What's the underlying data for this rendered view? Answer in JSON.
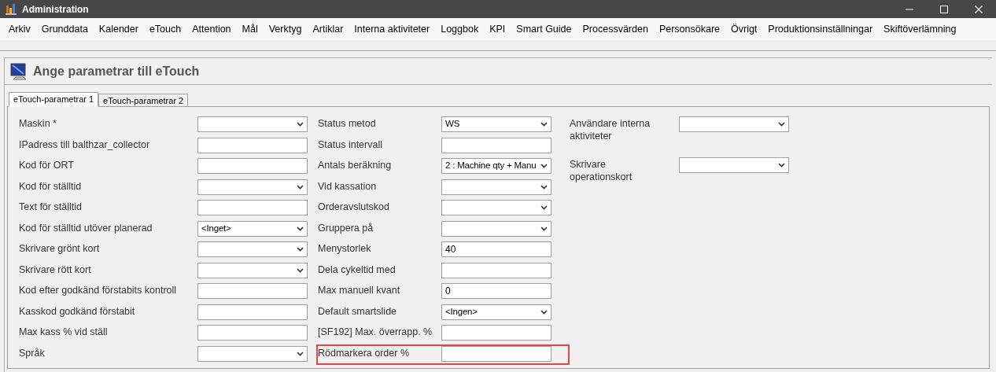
{
  "window": {
    "title": "Administration"
  },
  "menu": [
    "Arkiv",
    "Grunddata",
    "Kalender",
    "eTouch",
    "Attention",
    "Mål",
    "Verktyg",
    "Artiklar",
    "Interna aktiviteter",
    "Loggbok",
    "KPI",
    "Smart Guide",
    "Processvärden",
    "Personsökare",
    "Övrigt",
    "Produktionsinställningar",
    "Skiftöverlämning"
  ],
  "panel": {
    "title": "Ange parametrar till eTouch"
  },
  "tabs": [
    {
      "label": "eTouch-parametrar 1",
      "selected": true
    },
    {
      "label": "eTouch-parametrar 2",
      "selected": false
    }
  ],
  "columns": [
    [
      {
        "label": "Maskin *",
        "kind": "select",
        "highlighted": false
      },
      {
        "label": "IPadress till balthzar_collector",
        "kind": "text",
        "highlighted": false
      },
      {
        "label": "Kod för ORT",
        "kind": "text",
        "highlighted": false
      },
      {
        "label": "Kod för ställtid",
        "kind": "select",
        "highlighted": false
      },
      {
        "label": "Text för ställtid",
        "kind": "text",
        "highlighted": false
      },
      {
        "label": "Kod för ställtid utöver planerad",
        "kind": "select",
        "value": "<Inget>",
        "highlighted": false
      },
      {
        "label": "Skrivare grönt kort",
        "kind": "select",
        "highlighted": false
      },
      {
        "label": "Skrivare rött kort",
        "kind": "select",
        "highlighted": false
      },
      {
        "label": "Kod efter godkänd förstabits kontroll",
        "kind": "text",
        "highlighted": false
      },
      {
        "label": "Kasskod godkänd förstabit",
        "kind": "text",
        "highlighted": false
      },
      {
        "label": "Max kass % vid ställ",
        "kind": "text",
        "highlighted": false
      },
      {
        "label": "Språk",
        "kind": "select",
        "highlighted": false
      }
    ],
    [
      {
        "label": "Status metod",
        "kind": "select",
        "value": "WS",
        "highlighted": false
      },
      {
        "label": "Status intervall",
        "kind": "text",
        "highlighted": false
      },
      {
        "label": "Antals beräkning",
        "kind": "select",
        "value": "2 : Machine qty + Manu",
        "highlighted": false
      },
      {
        "label": "Vid kassation",
        "kind": "select",
        "highlighted": false
      },
      {
        "label": "Orderavslutskod",
        "kind": "select",
        "highlighted": false
      },
      {
        "label": "Gruppera på",
        "kind": "select",
        "highlighted": false
      },
      {
        "label": "Menystorlek",
        "kind": "text",
        "value": "40",
        "highlighted": false
      },
      {
        "label": "Dela cykeltid med",
        "kind": "text",
        "highlighted": false
      },
      {
        "label": "Max manuell kvant",
        "kind": "text",
        "value": "0",
        "highlighted": false
      },
      {
        "label": "Default smartslide",
        "kind": "select",
        "value": "<Ingen>",
        "highlighted": false
      },
      {
        "label": "[SF192] Max. överrapp. %",
        "kind": "text",
        "highlighted": false
      },
      {
        "label": "Rödmarkera order %",
        "kind": "text",
        "highlighted": true
      }
    ],
    [
      {
        "label": "Användare interna aktiviteter",
        "kind": "select",
        "highlighted": false
      },
      {
        "label": "Skrivare operationskort",
        "kind": "select",
        "highlighted": false
      }
    ]
  ]
}
